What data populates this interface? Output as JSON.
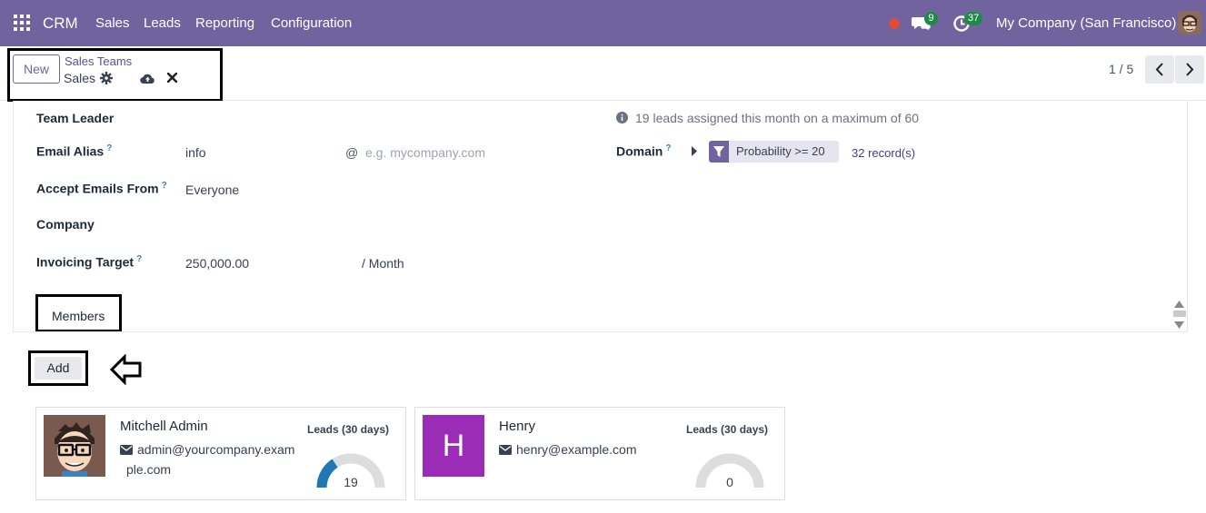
{
  "topbar": {
    "brand": "CRM",
    "menu": [
      "Sales",
      "Leads",
      "Reporting",
      "Configuration"
    ],
    "chat_count": "9",
    "activity_count": "37",
    "company": "My Company (San Francisco)"
  },
  "control": {
    "new_label": "New",
    "breadcrumb_parent": "Sales Teams",
    "breadcrumb_current": "Sales",
    "pager": "1 / 5"
  },
  "form": {
    "team_leader_label": "Team Leader",
    "leads_info": "19 leads assigned this month on a maximum of 60",
    "email_alias_label": "Email Alias",
    "email_alias_value": "info",
    "email_at": "@",
    "email_domain_placeholder": "e.g. mycompany.com",
    "domain_label": "Domain",
    "domain_filter": "Probability >= 20",
    "domain_records": "32 record(s)",
    "accept_emails_label": "Accept Emails From",
    "accept_emails_value": "Everyone",
    "company_label": "Company",
    "invoicing_label": "Invoicing Target",
    "invoicing_value": "250,000.00",
    "invoicing_period": "/ Month",
    "tooltip_mark": "?"
  },
  "tabs": {
    "members_label": "Members"
  },
  "members": {
    "add_label": "Add",
    "gauge_max": 60,
    "cards": [
      {
        "name": "Mitchell Admin",
        "email_line1": "admin@yourcompany.exam",
        "email_line2": "ple.com",
        "leads_label": "Leads (30 days)",
        "leads_value": "19",
        "leads_number": 19
      },
      {
        "name": "Henry",
        "initial": "H",
        "email_line1": "henry@example.com",
        "leads_label": "Leads (30 days)",
        "leads_value": "0",
        "leads_number": 0
      }
    ]
  },
  "colors": {
    "brand": "#71639e",
    "gauge_fill": "#1f77b4",
    "gauge_track": "#dddddd",
    "henry_avatar": "#9b2cb8"
  }
}
